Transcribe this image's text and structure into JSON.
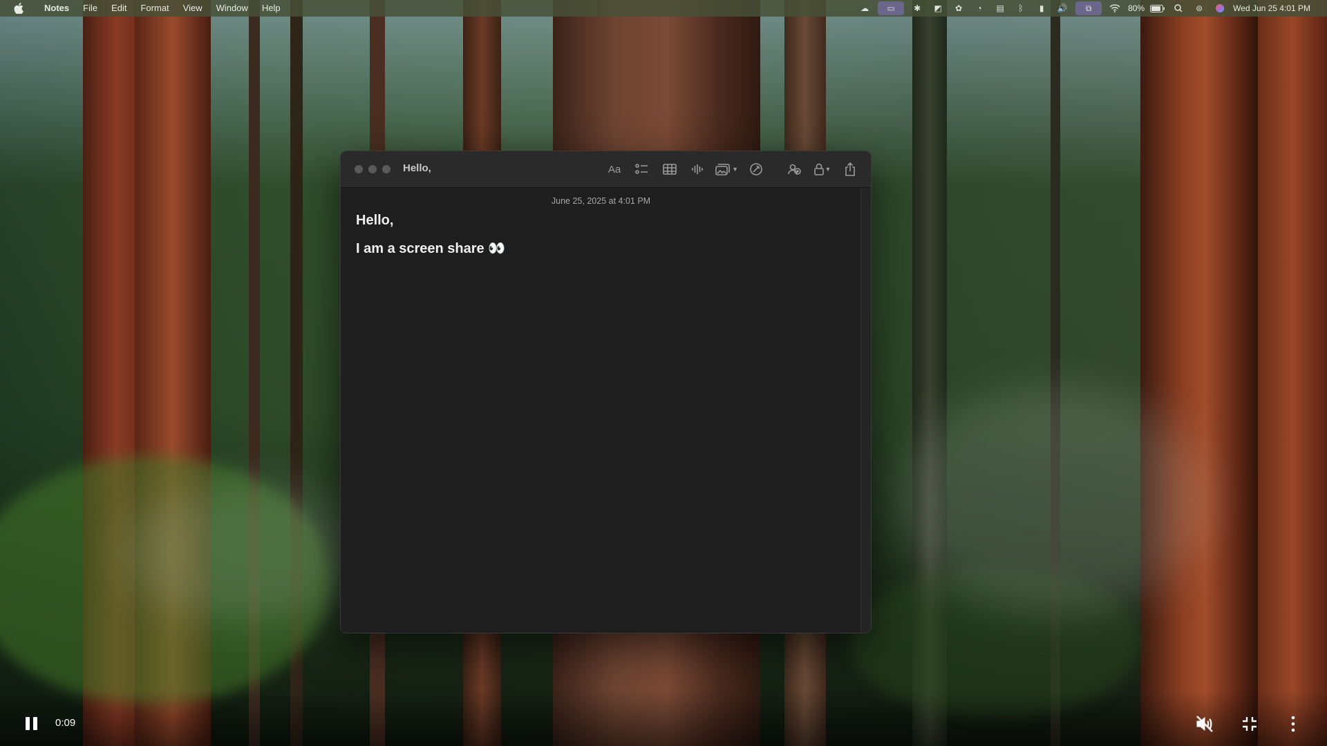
{
  "menubar": {
    "app_name": "Notes",
    "menus": [
      "File",
      "Edit",
      "Format",
      "View",
      "Window",
      "Help"
    ],
    "battery": "80%",
    "datetime": "Wed Jun 25  4:01 PM",
    "status_icons": [
      "cloud-icon",
      "screen-mirror-icon",
      "gear-icon",
      "vpn-icon",
      "flower-icon",
      "vlc-icon",
      "keyboard-icon",
      "bluetooth-icon",
      "phone-icon",
      "volume-icon",
      "screen-share-icon",
      "wifi-icon",
      "battery-icon",
      "search-icon",
      "control-center-icon",
      "siri-icon"
    ]
  },
  "window": {
    "title": "Hello,",
    "toolbar": {
      "format_label": "Aa",
      "icons": [
        "checklist-icon",
        "table-icon",
        "audio-waveform-icon",
        "media-icon",
        "markup-icon",
        "collaborate-icon",
        "lock-icon",
        "share-icon"
      ]
    },
    "note": {
      "date": "June 25, 2025 at 4:01 PM",
      "line1": "Hello,",
      "line2": "I am a screen share 👀"
    }
  },
  "video": {
    "time": "0:09",
    "state": "playing"
  }
}
